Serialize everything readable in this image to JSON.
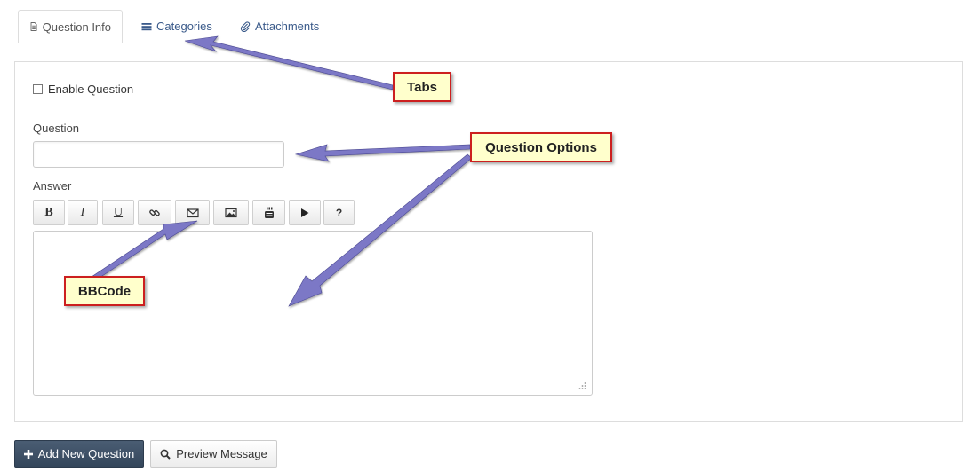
{
  "tabs": [
    {
      "label": "Question Info",
      "icon": "document-icon",
      "active": true
    },
    {
      "label": "Categories",
      "icon": "list-icon",
      "active": false
    },
    {
      "label": "Attachments",
      "icon": "paperclip-icon",
      "active": false
    }
  ],
  "form": {
    "enable_label": "Enable Question",
    "enable_checked": false,
    "question_label": "Question",
    "question_value": "",
    "answer_label": "Answer",
    "answer_value": ""
  },
  "toolbar": {
    "bold": "B",
    "italic": "I",
    "underline": "U",
    "help": "?"
  },
  "buttons": {
    "add_new": "Add New Question",
    "preview": "Preview Message"
  },
  "callouts": {
    "tabs": "Tabs",
    "question_options": "Question Options",
    "bbcode": "BBCode"
  },
  "colors": {
    "callout_bg": "#ffffcc",
    "callout_border": "#cc1f1f",
    "arrow": "#7b78c6",
    "primary_button": "#3f5167",
    "tab_link": "#3a5a8a"
  }
}
